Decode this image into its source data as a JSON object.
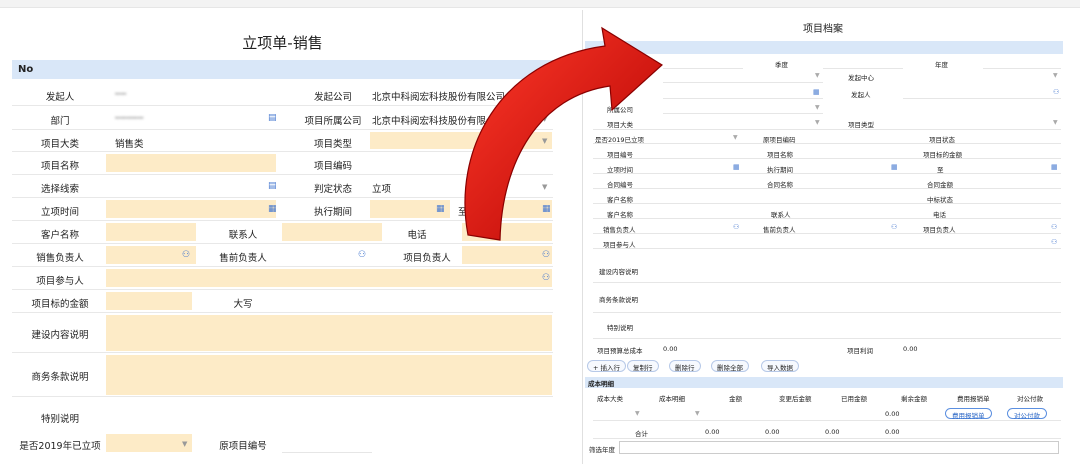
{
  "left": {
    "title": "立项单-销售",
    "section": "No",
    "initiator": {
      "label": "发起人",
      "value": "╍╍"
    },
    "company": {
      "label": "发起公司",
      "value": "北京中科阅宏科技股份有限公司"
    },
    "dept": {
      "label": "部门",
      "value": "╍╍╍╍╍"
    },
    "belong_company": {
      "label": "项目所属公司",
      "value": "北京中科阅宏科技股份有限公司"
    },
    "category": {
      "label": "项目大类",
      "value": "销售类"
    },
    "type": {
      "label": "项目类型"
    },
    "name": {
      "label": "项目名称"
    },
    "code": {
      "label": "项目编码"
    },
    "clue": {
      "label": "选择线索"
    },
    "status": {
      "label": "判定状态",
      "value": "立项"
    },
    "start": {
      "label": "立项时间"
    },
    "period": {
      "label": "执行期间",
      "to": "至"
    },
    "customer": {
      "label": "客户名称"
    },
    "contact": {
      "label": "联系人"
    },
    "phone": {
      "label": "电话"
    },
    "sales": {
      "label": "销售负责人"
    },
    "presales": {
      "label": "售前负责人"
    },
    "pm": {
      "label": "项目负责人"
    },
    "members": {
      "label": "项目参与人"
    },
    "amount": {
      "label": "项目标的金额"
    },
    "upper": {
      "label": "大写"
    },
    "content": {
      "label": "建设内容说明"
    },
    "terms": {
      "label": "商务条款说明"
    },
    "special": {
      "label": "特别说明"
    },
    "y2019": {
      "label": "是否2019年已立项"
    },
    "orig_code": {
      "label": "原项目编号"
    }
  },
  "right": {
    "title": "项目档案",
    "season": "季度",
    "year": "年度",
    "center": "发起中心",
    "initiator": "发起人",
    "company": "所属公司",
    "category": "项目大类",
    "type": "项目类型",
    "y2019": "是否2019已立项",
    "orig_code": "原项目编码",
    "status": "项目状态",
    "code": "项目编号",
    "name": "项目名称",
    "amount": "项目标的金额",
    "start": "立项时间",
    "period": "执行期间",
    "to": "至",
    "contract_code": "合同编号",
    "contract_name": "合同名称",
    "contract_amount": "合同金额",
    "customer": "客户名称",
    "bid_status": "中标状态",
    "customer2": "客户名称",
    "contact": "联系人",
    "phone": "电话",
    "sales": "销售负责人",
    "presales": "售前负责人",
    "pm": "项目负责人",
    "members": "项目参与人",
    "content": "建设内容说明",
    "terms": "商务条款说明",
    "special": "特别说明",
    "budget": "项目预算总成本",
    "budget_val": "0.00",
    "profit": "项目利润",
    "profit_val": "0.00",
    "buttons": [
      "+ 插入行",
      "复制行",
      "删除行",
      "删除全部",
      "导入数据"
    ],
    "cost_section": "成本明细",
    "cols": [
      "成本大类",
      "成本明细",
      "金额",
      "变更后金额",
      "已用金额",
      "剩余金额",
      "费用报销单",
      "对公付款"
    ],
    "row_val": "0.00",
    "pill1": "费用报销单",
    "pill2": "对公付款",
    "total": "合计",
    "totals": [
      "0.00",
      "0.00",
      "0.00",
      "0.00"
    ],
    "filter_year": "筛选年度"
  },
  "colors": {
    "accent_blue": "#d9e7f8",
    "field_fill": "#fdebc7",
    "arrow_red": "#e01010"
  }
}
